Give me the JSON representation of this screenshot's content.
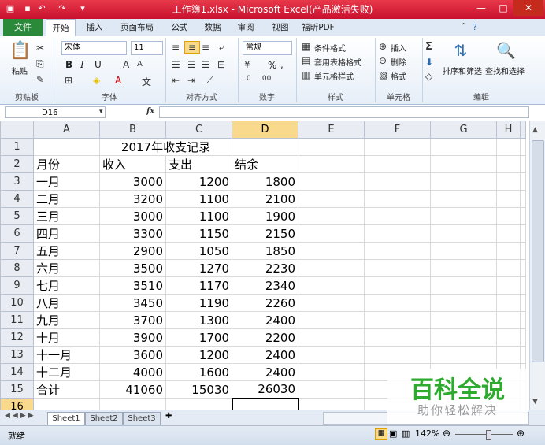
{
  "window": {
    "title": "工作簿1.xlsx - Microsoft Excel(产品激活失败)",
    "colors": {
      "titlebar": "#c8102e",
      "file_tab": "#2a8a3a",
      "selected_header": "#f9d98c"
    }
  },
  "ribbon_tabs": {
    "file": "文件",
    "items": [
      "开始",
      "插入",
      "页面布局",
      "公式",
      "数据",
      "审阅",
      "视图",
      "福昕PDF"
    ],
    "active": "开始"
  },
  "ribbon": {
    "clipboard": {
      "label": "剪贴板",
      "paste": "粘贴"
    },
    "font": {
      "label": "字体",
      "name": "宋体",
      "size": "11",
      "bold": "B",
      "italic": "I",
      "underline": "U"
    },
    "alignment": {
      "label": "对齐方式"
    },
    "number": {
      "label": "数字",
      "format": "常规",
      "percent": "%"
    },
    "styles": {
      "label": "样式",
      "items": [
        "条件格式",
        "套用表格格式",
        "单元格样式"
      ]
    },
    "cells": {
      "label": "单元格",
      "items": [
        "插入",
        "删除",
        "格式"
      ]
    },
    "editing": {
      "label": "编辑",
      "sort_filter": "排序和筛选",
      "find_select": "查找和选择"
    }
  },
  "formula_bar": {
    "name_box": "D16",
    "fx": "fx",
    "formula": ""
  },
  "columns": [
    "A",
    "B",
    "C",
    "D",
    "E",
    "F",
    "G",
    "H"
  ],
  "selected_cell": "D16",
  "rows": [
    {
      "n": "1",
      "A": "",
      "B": "2017年收支记录",
      "C": "",
      "D": ""
    },
    {
      "n": "2",
      "A": "月份",
      "B": "收入",
      "C": "支出",
      "D": "结余"
    },
    {
      "n": "3",
      "A": "一月",
      "B": "3000",
      "C": "1200",
      "D": "1800"
    },
    {
      "n": "4",
      "A": "二月",
      "B": "3200",
      "C": "1100",
      "D": "2100"
    },
    {
      "n": "5",
      "A": "三月",
      "B": "3000",
      "C": "1100",
      "D": "1900"
    },
    {
      "n": "6",
      "A": "四月",
      "B": "3300",
      "C": "1150",
      "D": "2150"
    },
    {
      "n": "7",
      "A": "五月",
      "B": "2900",
      "C": "1050",
      "D": "1850"
    },
    {
      "n": "8",
      "A": "六月",
      "B": "3500",
      "C": "1270",
      "D": "2230"
    },
    {
      "n": "9",
      "A": "七月",
      "B": "3510",
      "C": "1170",
      "D": "2340"
    },
    {
      "n": "10",
      "A": "八月",
      "B": "3450",
      "C": "1190",
      "D": "2260"
    },
    {
      "n": "11",
      "A": "九月",
      "B": "3700",
      "C": "1300",
      "D": "2400"
    },
    {
      "n": "12",
      "A": "十月",
      "B": "3900",
      "C": "1700",
      "D": "2200"
    },
    {
      "n": "13",
      "A": "十一月",
      "B": "3600",
      "C": "1200",
      "D": "2400"
    },
    {
      "n": "14",
      "A": "十二月",
      "B": "4000",
      "C": "1600",
      "D": "2400"
    },
    {
      "n": "15",
      "A": "合计",
      "B": "41060",
      "C": "15030",
      "D": "26030"
    },
    {
      "n": "16",
      "A": "",
      "B": "",
      "C": "",
      "D": ""
    }
  ],
  "sheets": [
    "Sheet1",
    "Sheet2",
    "Sheet3"
  ],
  "status": {
    "ready": "就绪",
    "zoom": "142%"
  },
  "watermark": {
    "line1": "百科全说",
    "line2": "助你轻松解决"
  }
}
